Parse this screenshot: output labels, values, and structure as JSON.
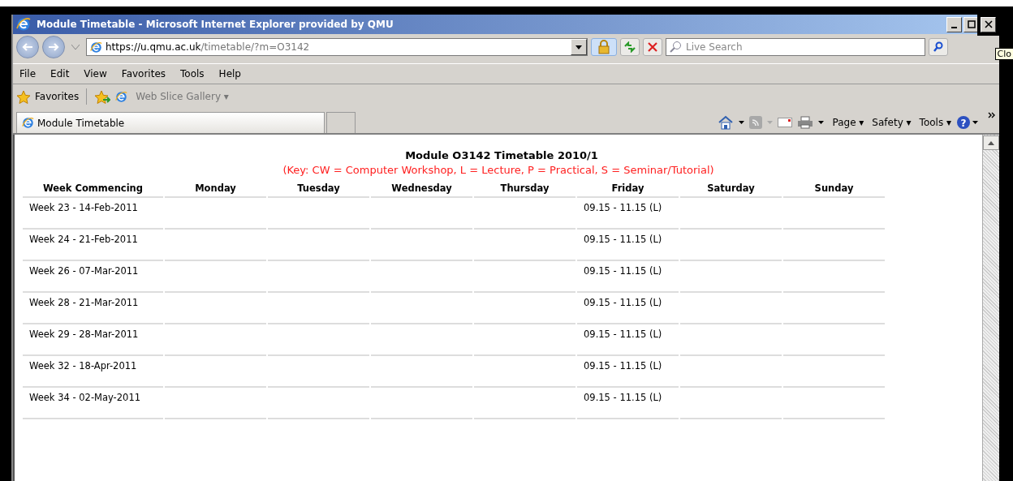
{
  "window": {
    "title": "Module Timetable - Microsoft Internet Explorer provided by QMU",
    "tooltip": "Clo"
  },
  "address_bar": {
    "host": "https://u.qmu.ac.uk",
    "path": "/timetable/?m=O3142"
  },
  "search": {
    "placeholder": "Live Search"
  },
  "menu": [
    "File",
    "Edit",
    "View",
    "Favorites",
    "Tools",
    "Help"
  ],
  "favorites_bar": {
    "favorites": "Favorites",
    "web_slice": "Web Slice Gallery ▾"
  },
  "tabs": [
    {
      "label": "Module Timetable",
      "selected": true
    }
  ],
  "command_bar": [
    "Page ▾",
    "Safety ▾",
    "Tools ▾"
  ],
  "help_glyph": "?",
  "page": {
    "heading": "Module O3142 Timetable 2010/1",
    "key": "(Key: CW = Computer Workshop, L = Lecture, P = Practical, S = Seminar/Tutorial)",
    "columns": [
      "Week Commencing",
      "Monday",
      "Tuesday",
      "Wednesday",
      "Thursday",
      "Friday",
      "Saturday",
      "Sunday"
    ],
    "rows": [
      [
        "Week 23 - 14-Feb-2011",
        "",
        "",
        "",
        "",
        "09.15 - 11.15 (L)",
        "",
        ""
      ],
      [
        "Week 24 - 21-Feb-2011",
        "",
        "",
        "",
        "",
        "09.15 - 11.15 (L)",
        "",
        ""
      ],
      [
        "Week 26 - 07-Mar-2011",
        "",
        "",
        "",
        "",
        "09.15 - 11.15 (L)",
        "",
        ""
      ],
      [
        "Week 28 - 21-Mar-2011",
        "",
        "",
        "",
        "",
        "09.15 - 11.15 (L)",
        "",
        ""
      ],
      [
        "Week 29 - 28-Mar-2011",
        "",
        "",
        "",
        "",
        "09.15 - 11.15 (L)",
        "",
        ""
      ],
      [
        "Week 32 - 18-Apr-2011",
        "",
        "",
        "",
        "",
        "09.15 - 11.15 (L)",
        "",
        ""
      ],
      [
        "Week 34 - 02-May-2011",
        "",
        "",
        "",
        "",
        "09.15 - 11.15 (L)",
        "",
        ""
      ]
    ]
  }
}
